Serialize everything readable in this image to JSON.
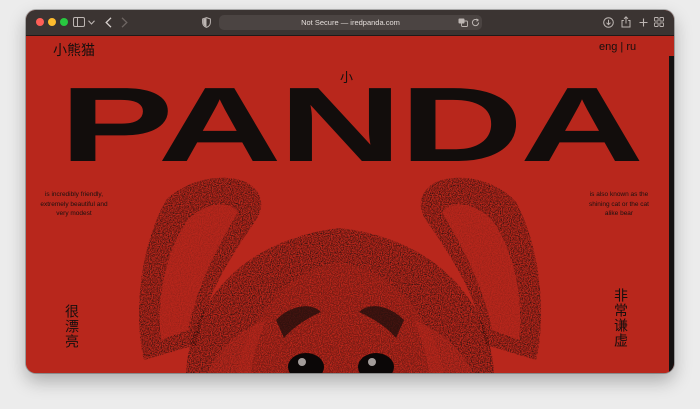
{
  "browser": {
    "url_text": "Not Secure — iredpanda.com"
  },
  "site": {
    "logo": "小熊猫",
    "language_switch": "eng | ru",
    "top_char": "小",
    "headline": "PANDA",
    "blurb_left": "is incredibly friendly, extremely beautiful and very modest",
    "blurb_right": "is also known as the shining cat or the cat alike bear",
    "vertical_left": "很漂亮",
    "vertical_right": "非常谦虚"
  },
  "colors": {
    "accent": "#b8271c",
    "ink": "#120d0c"
  }
}
